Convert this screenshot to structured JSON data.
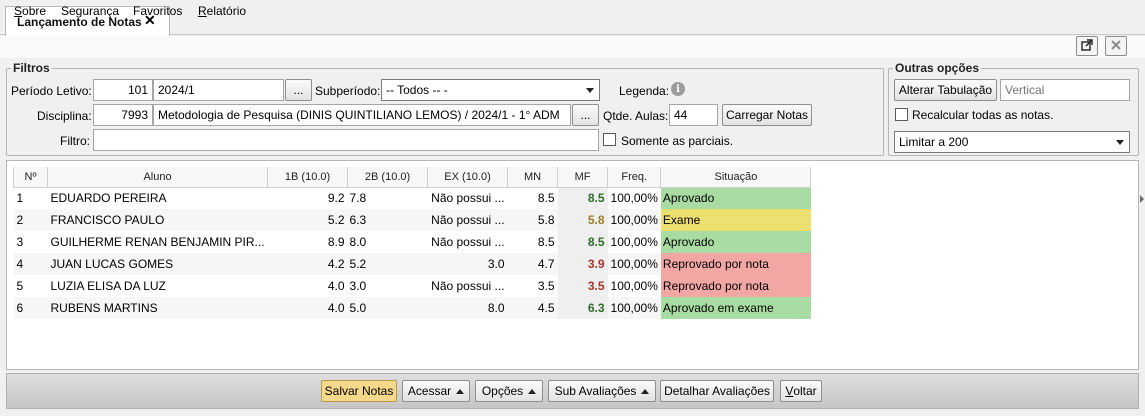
{
  "tab": {
    "title": "Lançamento de Notas",
    "close_glyph": "✕"
  },
  "menu": {
    "items": [
      {
        "first": "S",
        "rest": "obre"
      },
      {
        "first": "",
        "rest": "Segurança"
      },
      {
        "first": "",
        "rest": "Favoritos"
      },
      {
        "first": "R",
        "rest": "elatório"
      }
    ]
  },
  "filtros": {
    "title": "Filtros",
    "periodo_label": "Período Letivo:",
    "periodo_code": "101",
    "periodo_value": "2024/1",
    "lookup_label": "...",
    "subperiodo_label": "Subperíodo:",
    "subperiodo_value": "-- Todos -- -",
    "legenda_label": "Legenda:",
    "disciplina_label": "Disciplina:",
    "disciplina_code": "7993",
    "disciplina_value": "Metodologia de Pesquisa (DINIS QUINTILIANO LEMOS) / 2024/1 - 1° ADM",
    "qtde_label": "Qtde. Aulas:",
    "qtde_value": "44",
    "carregar_label": "Carregar Notas",
    "filtro_label": "Filtro:",
    "filtro_value": "",
    "parciais_label": "Somente as parciais."
  },
  "outras": {
    "title": "Outras opções",
    "alterar_label": "Alterar Tabulação",
    "tabulacao_placeholder": "Vertical",
    "recalcular_label": "Recalcular todas as notas.",
    "limitar_value": "Limitar a 200"
  },
  "table": {
    "headers": [
      "Nº",
      "Aluno",
      "1B (10.0)",
      "2B (10.0)",
      "EX (10.0)",
      "MN",
      "MF",
      "Freq.",
      "Situação"
    ],
    "rows": [
      {
        "n": "1",
        "aluno": "EDUARDO PEREIRA",
        "b1": "9.2",
        "b2": "7.8",
        "ex": "Não possui ...",
        "mn": "8.5",
        "mf": "8.5",
        "freq": "100,00%",
        "sit": "Aprovado",
        "status": "green"
      },
      {
        "n": "2",
        "aluno": "FRANCISCO PAULO",
        "b1": "5.2",
        "b2": "6.3",
        "ex": "Não possui ...",
        "mn": "5.8",
        "mf": "5.8",
        "freq": "100,00%",
        "sit": "Exame",
        "status": "yellow"
      },
      {
        "n": "3",
        "aluno": "GUILHERME RENAN BENJAMIN PIR...",
        "b1": "8.9",
        "b2": "8.0",
        "ex": "Não possui ...",
        "mn": "8.5",
        "mf": "8.5",
        "freq": "100,00%",
        "sit": "Aprovado",
        "status": "green"
      },
      {
        "n": "4",
        "aluno": "JUAN LUCAS GOMES",
        "b1": "4.2",
        "b2": "5.2",
        "ex": "3.0",
        "mn": "4.7",
        "mf": "3.9",
        "freq": "100,00%",
        "sit": "Reprovado por nota",
        "status": "red"
      },
      {
        "n": "5",
        "aluno": "LUZIA ELISA DA LUZ",
        "b1": "4.0",
        "b2": "3.0",
        "ex": "Não possui ...",
        "mn": "3.5",
        "mf": "3.5",
        "freq": "100,00%",
        "sit": "Reprovado por nota",
        "status": "red"
      },
      {
        "n": "6",
        "aluno": "RUBENS MARTINS",
        "b1": "4.0",
        "b2": "5.0",
        "ex": "8.0",
        "mn": "4.5",
        "mf": "6.3",
        "freq": "100,00%",
        "sit": "Aprovado em exame",
        "status": "green"
      }
    ]
  },
  "status_colors": {
    "green": {
      "bg": "#a9dca2",
      "mf": "#2f6b2a"
    },
    "yellow": {
      "bg": "#ece070",
      "mf": "#9a7d2a"
    },
    "red": {
      "bg": "#f2a7a5",
      "mf": "#b0322c"
    }
  },
  "bottom": {
    "salvar": "Salvar Notas",
    "acessar": "Acessar",
    "opcoes": "Opções",
    "sub": "Sub Avaliações",
    "detalhar": "Detalhar Avaliações",
    "voltar_first": "V",
    "voltar_rest": "oltar"
  },
  "icons": {
    "popout": "popout-icon",
    "close": "close-icon",
    "info": "info-icon"
  }
}
